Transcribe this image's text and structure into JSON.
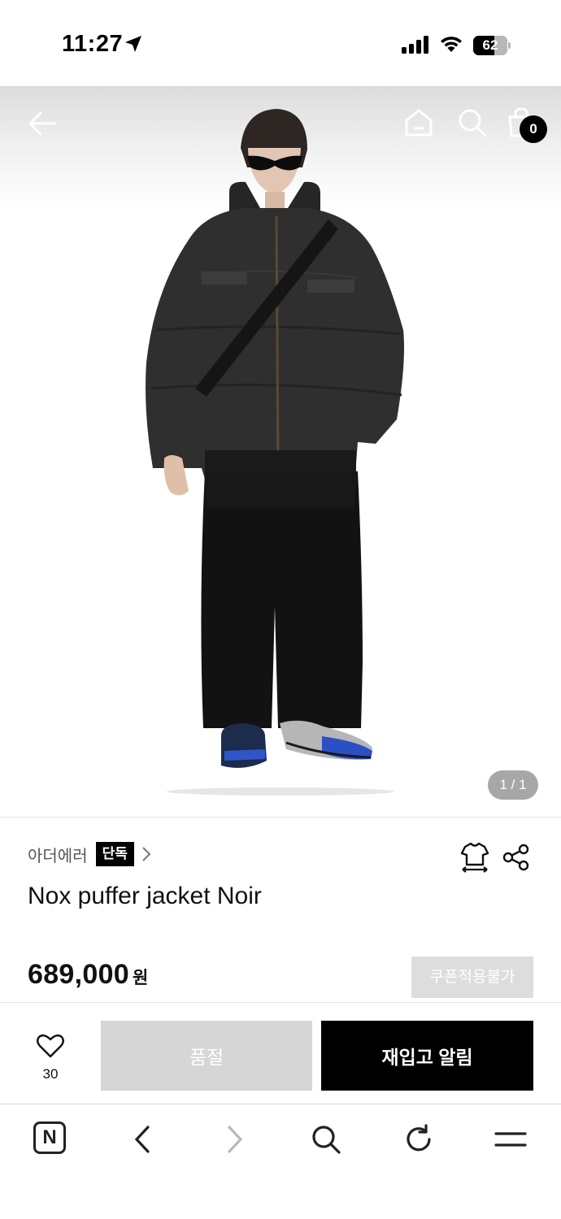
{
  "status_bar": {
    "time": "11:27",
    "battery_level": "62"
  },
  "hero": {
    "page_counter": "1 / 1",
    "cart_count": "0"
  },
  "product": {
    "brand": "아더에러",
    "exclusive_badge": "단독",
    "title": "Nox puffer jacket Noir",
    "price": "689,000",
    "price_unit": "원",
    "coupon_badge": "쿠폰적용불가"
  },
  "actions": {
    "like_count": "30",
    "soldout_label": "품절",
    "restock_label": "재입고 알림"
  },
  "icons": {
    "back": "arrow-left-icon",
    "home": "home-icon",
    "search": "search-icon",
    "bag": "shopping-bag-icon",
    "size_guide": "shirt-size-icon",
    "share": "share-icon",
    "like": "heart-icon",
    "browser_logo": "naver-n-icon",
    "browser_back": "chevron-left-icon",
    "browser_forward": "chevron-right-icon",
    "browser_search": "search-icon",
    "browser_refresh": "refresh-icon",
    "browser_menu": "menu-icon"
  },
  "colors": {
    "accent": "#000000",
    "disabled": "#d6d6d6",
    "badge_gray": "#a7a7a7"
  }
}
